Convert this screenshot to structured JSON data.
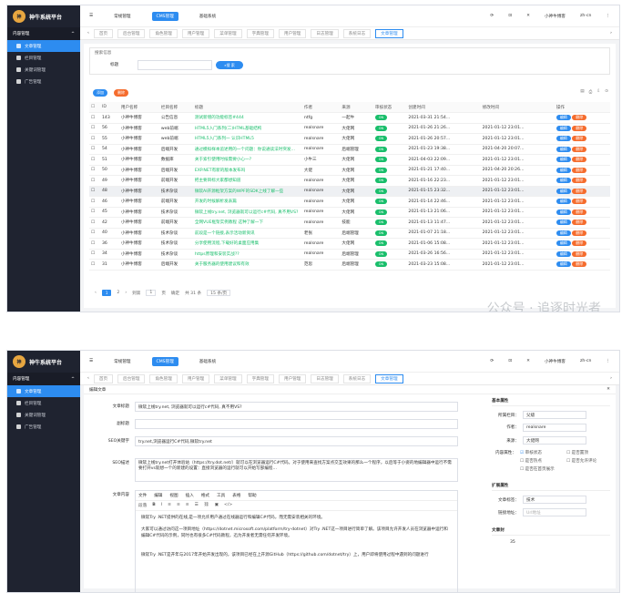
{
  "app": {
    "name": "神牛系统平台",
    "badge": "神"
  },
  "sidebar": {
    "group": "内容管理",
    "items": [
      {
        "label": "文章管理"
      },
      {
        "label": "栏目管理"
      },
      {
        "label": "关键词管理"
      },
      {
        "label": "广告管理"
      }
    ]
  },
  "topbar": {
    "menus": [
      "常规管理",
      "CMS管理",
      "基础系统"
    ],
    "user": "小神牛博客",
    "lang": "zh-cn"
  },
  "tabs": [
    "首页",
    "后台管理",
    "角色管理",
    "用户管理",
    "菜单管理",
    "字典管理",
    "用户管理",
    "日志管理",
    "系统日志",
    "文章管理"
  ],
  "list": {
    "search_section": "搜索信息",
    "search_label": "标题",
    "search_btn": "搜 索",
    "add_btn": "添加",
    "delete_btn": "删除",
    "columns": [
      "ID",
      "用户名称",
      "栏目名称",
      "标题",
      "作者",
      "来源",
      "审核状态",
      "创建时间",
      "修改时间",
      "操作"
    ],
    "rows": [
      [
        "143",
        "小神牛博客",
        "公告信息",
        "测试新增的功能标签#444",
        "ntfg",
        "一起牛",
        "2021-03-31 21:54...",
        ""
      ],
      [
        "56",
        "小神牛博客",
        "web前端",
        "HTML5入门系列(二)HTML基础结构",
        "realsnare",
        "大佬网",
        "2021-01-26 21:26...",
        "2021-01-12 23:01..."
      ],
      [
        "55",
        "小神牛博客",
        "web前端",
        "HTML5入门系列一 认识HTML5",
        "realsnare",
        "大佬网",
        "2021-01-26 20:57...",
        "2021-01-12 23:01..."
      ],
      [
        "54",
        "小神牛博客",
        "后端开发",
        "通过模拟样本追述用的一个问题：你说通读法时突发...",
        "realsnare",
        "后端管理",
        "2021-01-23 19:38...",
        "2021-04-20 20:07..."
      ],
      [
        "51",
        "小神牛博客",
        "数据库",
        "关于索引使用时候需要小心一?",
        "小牛三",
        "大佬网",
        "2021-04-03 22:09...",
        "2021-01-12 23:01..."
      ],
      [
        "50",
        "小神牛博客",
        "后端开发",
        "EXP.NET有新的版本发布吗",
        "大佬",
        "大佬网",
        "2021-01-21 17:40...",
        "2021-04-20 20:26..."
      ],
      [
        "49",
        "小神牛博客",
        "前端开发",
        "把主要目标大家都想知道",
        "realsnare",
        "大佬网",
        "2021-01-16 22:23...",
        "2021-01-12 23:01..."
      ],
      [
        "48",
        "小神牛博客",
        "技术杂谈",
        "微软AI开源框架方案的WPF的SDK上线了解一些",
        "realsnare",
        "大佬网",
        "2021-01-15 23:32...",
        "2021-01-12 23:01..."
      ],
      [
        "46",
        "小神牛博客",
        "前端开发",
        "开发的时候解析发表篇",
        "realsnare",
        "大佬网",
        "2021-01-14 22:46...",
        "2021-01-12 23:01..."
      ],
      [
        "45",
        "小神牛博客",
        "技术杂谈",
        "微软上线try.net, 浏览器就可以运行c#代码, 真不用VS?",
        "realsnare",
        "大佬网",
        "2021-01-13 21:06...",
        "2021-01-12 23:01..."
      ],
      [
        "42",
        "小神牛博客",
        "前端开发",
        "全网VUE框架实例教程 这种了解一下",
        "realsnare",
        "技能",
        "2021-01-13 11:47...",
        "2021-01-12 23:01..."
      ],
      [
        "40",
        "小神牛博客",
        "技术杂谈",
        "前段是一个链接,表示活动新资讯",
        "老张",
        "后端管理",
        "2021-01-07 21:18...",
        "2021-01-12 23:01..."
      ],
      [
        "36",
        "小神牛博客",
        "技术杂谈",
        "分享使用流程,下载好的桌面应用集",
        "realsnare",
        "大佬网",
        "2021-01-06 15:08...",
        "2021-01-12 23:01..."
      ],
      [
        "34",
        "小神牛博客",
        "技术杂谈",
        "https原理和安装实战??",
        "realsnare",
        "后端管理",
        "2021-03-26 16:56...",
        "2021-01-12 23:01..."
      ],
      [
        "31",
        "小神牛博客",
        "后端开发",
        "关于服务器的使用建议和有效",
        "范思",
        "后端管理",
        "2021-03-23 15:08...",
        "2021-01-12 23:01..."
      ]
    ],
    "status_label": "ON",
    "edit_label": "编辑",
    "del_label": "删除",
    "pager": {
      "pages": [
        "1",
        "2"
      ],
      "goto": "到第",
      "page_input": "1",
      "page_unit": "页",
      "confirm": "确定",
      "total": "共 31 条",
      "size": "15 条/页"
    }
  },
  "watermark": "公众号 · 追逐时光者",
  "edit": {
    "header": "编辑文章",
    "title_label": "文章标题",
    "title_value": "微软上线try.net, 浏览器就可以运行c#代码, 真不用VS?",
    "subtitle_label": "副标题",
    "keywords_label": "SEO关键字",
    "keywords_value": "try.net,浏览器运行C#代码,微软try.net",
    "desc_label": "SEO描述",
    "desc_value": "微软上线try.net打开体验站（https://try.dot.net/）就可以在浏览器运行C#代码。对于使用来查找方案点交互效果的那么一个程序，以后等于小姿的地编辑器中运行不需要打开vs就想一个的新建的设置：直接浏览器的运行就可以开始写部编程...",
    "content_label": "文章内容",
    "editor_menu": [
      "文件",
      "编辑",
      "视图",
      "插入",
      "格式",
      "工具",
      "表格",
      "帮助"
    ],
    "editor_format": "段落",
    "editor_p1": "微软Try .NET提供的在线,是一项允许用户通过在线器运行和编辑C#代码，而无需安装相关的环境。",
    "editor_p2": "大家可以通过访问这一项目地址（https://dotnet.microsoft.com/platform/try-dotnet）对Try .NET这一项目进行简单了解。该项目允许开发人员在浏览器中运行和编辑C#代码的示例，同时也有很多C#代码教程，迅为开发者无需任何开发环境。",
    "editor_p3": "微软Try .NET是开年与2017年开始开发出现的，该项目已经在上开源GitHub（https://github.com/dotnet/try）上，用户即将使用过程中遇到的问题进行",
    "basic_title": "基本属性",
    "column_label": "所属栏目：",
    "column_value": "父级",
    "author_label": "作者：",
    "author_value": "realsnare",
    "source_label": "来源：",
    "source_value": "大佬网",
    "attr_label": "内容属性：",
    "attrs": [
      "审核状态",
      "是否置顶",
      "是否热点",
      "是否允许评论",
      "是否在首页展示"
    ],
    "ext_title": "扩展属性",
    "view_label": "文章标签：",
    "view_value": "技术",
    "tpl_label": "链接地址：",
    "tpl_value": "Url地址",
    "cover_title": "文章封",
    "cover_value": "35"
  }
}
